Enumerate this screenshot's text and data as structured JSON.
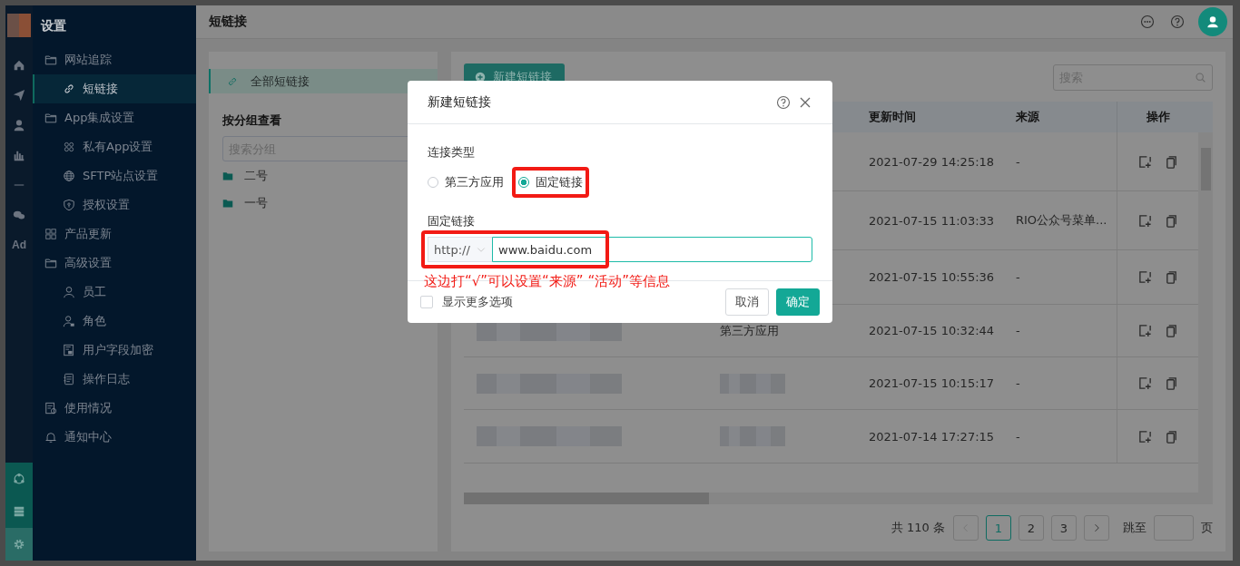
{
  "rail": {
    "ad_label": "Ad",
    "bottom": [
      {
        "selected": false
      },
      {
        "selected": false
      },
      {
        "selected": true
      }
    ]
  },
  "sidebar": {
    "title": "设置",
    "items": [
      {
        "label": "网站追踪",
        "selected": false,
        "children": [
          {
            "label": "短链接",
            "selected": true
          }
        ]
      },
      {
        "label": "App集成设置",
        "selected": false,
        "children": [
          {
            "label": "私有App设置",
            "selected": false
          },
          {
            "label": "SFTP站点设置",
            "selected": false
          },
          {
            "label": "授权设置",
            "selected": false
          }
        ]
      },
      {
        "label": "产品更新",
        "selected": false
      },
      {
        "label": "高级设置",
        "selected": false,
        "children": [
          {
            "label": "员工",
            "selected": false
          },
          {
            "label": "角色",
            "selected": false
          },
          {
            "label": "用户字段加密",
            "selected": false
          },
          {
            "label": "操作日志",
            "selected": false
          }
        ]
      },
      {
        "label": "使用情况",
        "selected": false
      },
      {
        "label": "通知中心",
        "selected": false
      }
    ]
  },
  "header": {
    "title": "短链接"
  },
  "groups_panel": {
    "all_item": {
      "label": "全部短链接",
      "selected": true
    },
    "heading": "按分组查看",
    "search": {
      "placeholder": "搜索分组"
    },
    "groups": [
      {
        "label": "二号",
        "selected": false
      },
      {
        "label": "一号",
        "selected": false
      }
    ]
  },
  "toolbar": {
    "new_button": "新建短链接",
    "search": {
      "placeholder": "搜索"
    }
  },
  "table": {
    "columns": [
      "更新时间",
      "来源",
      "操作"
    ],
    "rows": [
      {
        "updated": "2021-07-29 14:25:18",
        "source": "-"
      },
      {
        "updated": "2021-07-15 11:03:33",
        "source": "RIO公众号菜单..."
      },
      {
        "updated": "2021-07-15 10:55:36",
        "source": "-"
      },
      {
        "name": {
          "kind": "redacted"
        },
        "type": {
          "kind": "text",
          "text": "第三方应用"
        },
        "updated": "2021-07-15 10:32:44",
        "source": "-"
      },
      {
        "name": {
          "kind": "redacted"
        },
        "type": {
          "kind": "redacted"
        },
        "updated": "2021-07-15 10:15:17",
        "source": "-"
      },
      {
        "name": {
          "kind": "redacted"
        },
        "type": {
          "kind": "redacted"
        },
        "updated": "2021-07-14 17:27:15",
        "source": "-"
      }
    ]
  },
  "pagination": {
    "total": "共 110 条",
    "pages": [
      {
        "label": "1",
        "selected": true
      },
      {
        "label": "2",
        "selected": false
      },
      {
        "label": "3",
        "selected": false
      }
    ],
    "jump_label": "跳至",
    "page_suffix": "页"
  },
  "dialog": {
    "title": "新建短链接",
    "type_label": "连接类型",
    "types": [
      {
        "label": "第三方应用",
        "selected": false,
        "highlighted": false
      },
      {
        "label": "固定链接",
        "selected": true,
        "highlighted": true
      }
    ],
    "link_label": "固定链接",
    "protocol": "http://",
    "url": "www.baidu.com",
    "url_highlighted": true,
    "note": "这边打“√”可以设置“来源” “活动”等信息",
    "more_options": {
      "label": "显示更多选项",
      "checked": false
    },
    "buttons": [
      {
        "label": "取消",
        "kind": "secondary"
      },
      {
        "label": "确定",
        "kind": "primary"
      }
    ]
  }
}
